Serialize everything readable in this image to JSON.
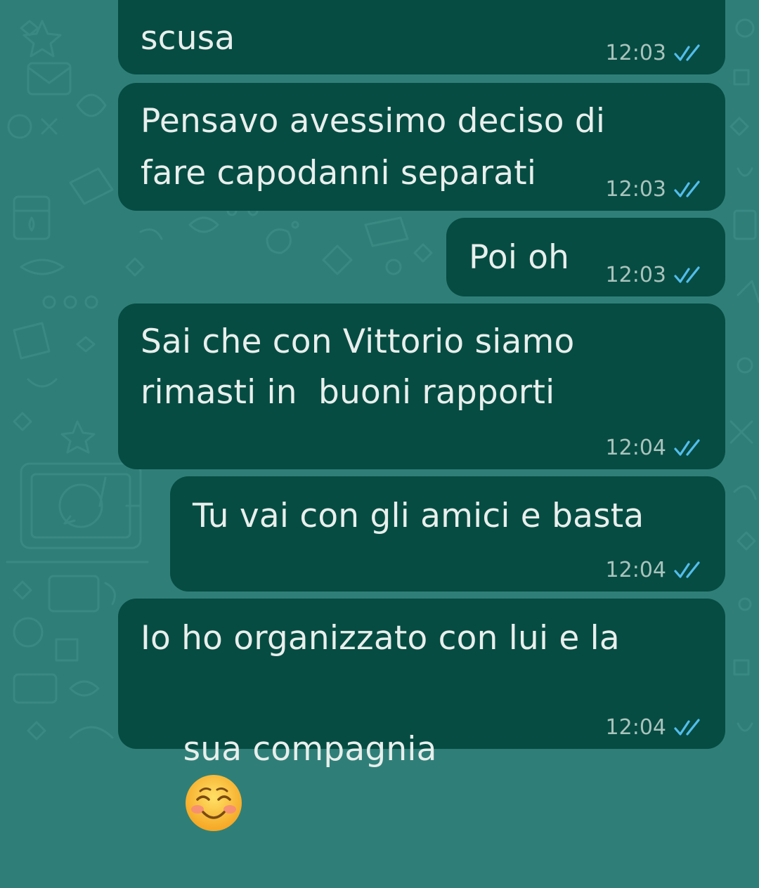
{
  "colors": {
    "wallpaper": "#2f7f78",
    "bubble": "#064c42",
    "text": "#e8efec",
    "time": "#a9c3bd",
    "read_ticks": "#53bdeb"
  },
  "messages": [
    {
      "lines": [
        "scusa"
      ],
      "time": "12:03",
      "status_icon": "double-check-read-icon"
    },
    {
      "lines": [
        "Pensavo avessimo deciso di",
        "fare capodanni separati"
      ],
      "time": "12:03",
      "status_icon": "double-check-read-icon"
    },
    {
      "lines": [
        "Poi oh"
      ],
      "time": "12:03",
      "status_icon": "double-check-read-icon"
    },
    {
      "lines": [
        "Sai che con Vittorio siamo",
        "rimasti in  buoni rapporti"
      ],
      "time": "12:04",
      "status_icon": "double-check-read-icon"
    },
    {
      "lines": [
        "Tu vai con gli amici e basta"
      ],
      "time": "12:04",
      "status_icon": "double-check-read-icon"
    },
    {
      "lines": [
        "Io ho organizzato con lui e la",
        "sua compagnia"
      ],
      "emoji": "smiling-face-with-smiling-eyes-emoji",
      "time": "12:04",
      "status_icon": "double-check-read-icon"
    }
  ]
}
